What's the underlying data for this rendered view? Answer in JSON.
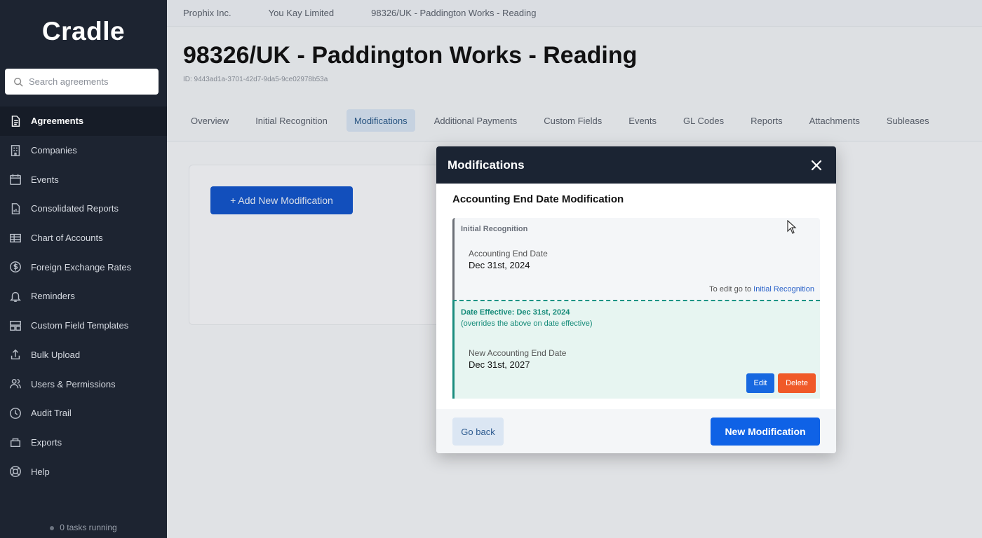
{
  "sidebar": {
    "brand": "Cradle",
    "search_placeholder": "Search agreements",
    "items": [
      {
        "label": "Agreements",
        "icon": "document-icon",
        "active": true
      },
      {
        "label": "Companies",
        "icon": "building-icon"
      },
      {
        "label": "Events",
        "icon": "calendar-icon"
      },
      {
        "label": "Consolidated Reports",
        "icon": "report-icon"
      },
      {
        "label": "Chart of Accounts",
        "icon": "table-icon"
      },
      {
        "label": "Foreign Exchange Rates",
        "icon": "dollar-circle-icon"
      },
      {
        "label": "Reminders",
        "icon": "bell-icon"
      },
      {
        "label": "Custom Field Templates",
        "icon": "template-icon"
      },
      {
        "label": "Bulk Upload",
        "icon": "upload-icon"
      },
      {
        "label": "Users & Permissions",
        "icon": "users-icon"
      },
      {
        "label": "Audit Trail",
        "icon": "clock-icon"
      },
      {
        "label": "Exports",
        "icon": "export-icon"
      },
      {
        "label": "Help",
        "icon": "help-icon"
      }
    ],
    "tasks": "0 tasks running"
  },
  "breadcrumbs": [
    "Prophix Inc.",
    "You Kay Limited",
    "98326/UK - Paddington Works - Reading"
  ],
  "page": {
    "title": "98326/UK - Paddington Works - Reading",
    "id_text": "ID: 9443ad1a-3701-42d7-9da5-9ce02978b53a"
  },
  "tabs": [
    {
      "label": "Overview"
    },
    {
      "label": "Initial Recognition"
    },
    {
      "label": "Modifications",
      "active": true
    },
    {
      "label": "Additional Payments"
    },
    {
      "label": "Custom Fields"
    },
    {
      "label": "Events"
    },
    {
      "label": "GL Codes"
    },
    {
      "label": "Reports"
    },
    {
      "label": "Attachments"
    },
    {
      "label": "Subleases"
    }
  ],
  "main": {
    "add_button": "+ Add New Modification"
  },
  "modal": {
    "title": "Modifications",
    "subtitle": "Accounting End Date Modification",
    "initial": {
      "label": "Initial Recognition",
      "field_label": "Accounting End Date",
      "field_value": "Dec 31st, 2024",
      "hint_prefix": "To edit go to",
      "hint_link": "Initial Recognition"
    },
    "effective": {
      "label": "Date Effective: Dec 31st, 2024",
      "sub": "(overrides the above on date effective)",
      "field_label": "New Accounting End Date",
      "field_value": "Dec 31st, 2027",
      "edit": "Edit",
      "delete": "Delete"
    },
    "go_back": "Go back",
    "new_modification": "New Modification"
  },
  "colors": {
    "sidebar_bg": "#1d2431",
    "primary": "#0f62e6",
    "danger": "#f05a28",
    "teal": "#1a8c7e"
  }
}
